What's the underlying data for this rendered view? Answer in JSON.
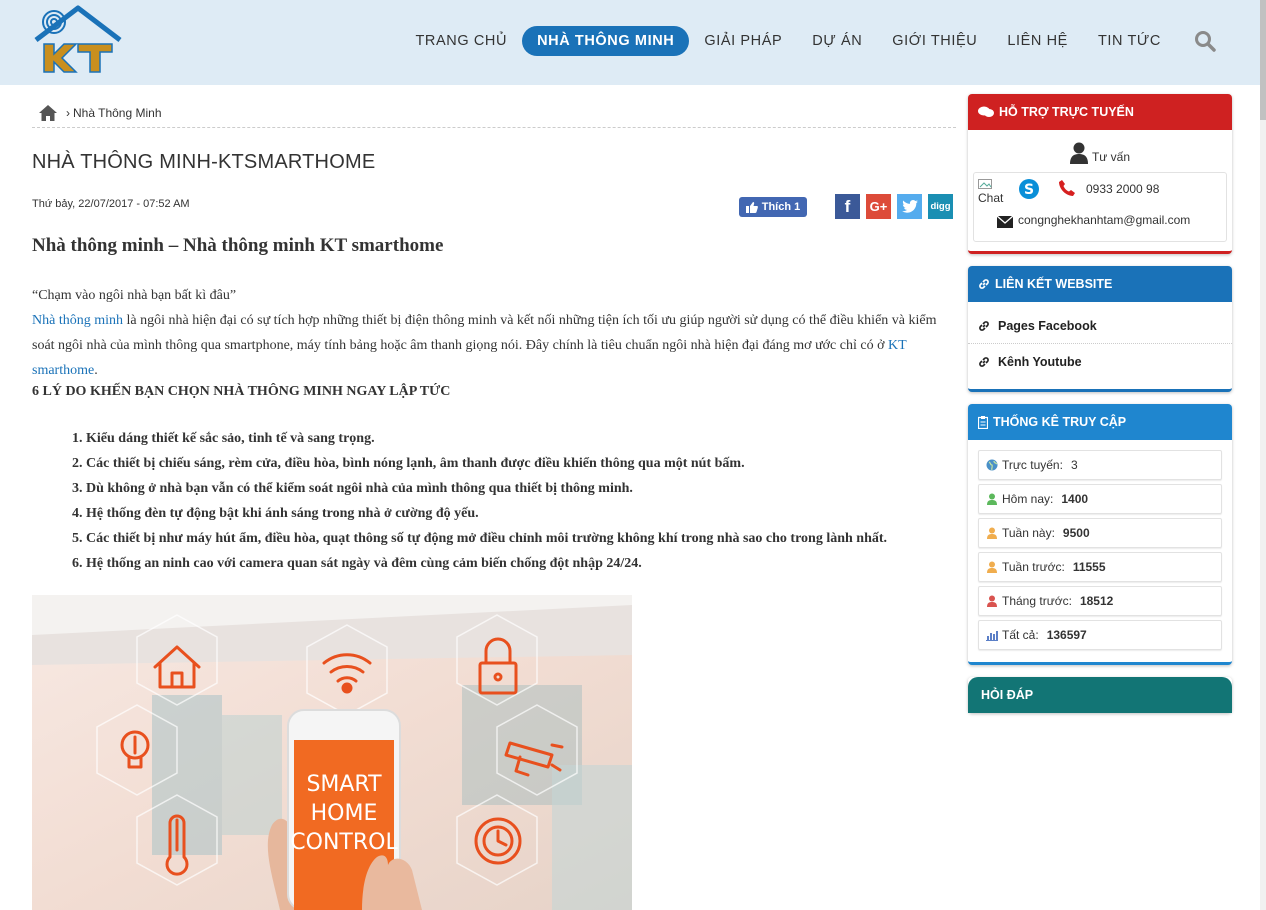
{
  "logo_text": "KT",
  "nav": {
    "items": [
      {
        "label": "TRANG CHỦ",
        "active": false
      },
      {
        "label": "NHÀ THÔNG MINH",
        "active": true
      },
      {
        "label": "GIẢI PHÁP",
        "active": false
      },
      {
        "label": "DỰ ÁN",
        "active": false
      },
      {
        "label": "GIỚI THIỆU",
        "active": false
      },
      {
        "label": "LIÊN HỆ",
        "active": false
      },
      {
        "label": "TIN TỨC",
        "active": false
      }
    ],
    "search_icon": "search-icon"
  },
  "breadcrumb": {
    "separator": "›",
    "current": "Nhà Thông Minh"
  },
  "page_title": "NHÀ THÔNG MINH-KTSMARTHOME",
  "post_date": "Thứ bảy, 22/07/2017 - 07:52 AM",
  "social": {
    "like_label": "Thích 1",
    "share": [
      {
        "name": "facebook",
        "glyph": "f",
        "color": "#3b5998"
      },
      {
        "name": "google-plus",
        "glyph": "G+",
        "color": "#dd4b39"
      },
      {
        "name": "twitter",
        "glyph": "t",
        "color": "#55acee"
      },
      {
        "name": "digg",
        "glyph": "digg",
        "color": "#1a8fb3"
      }
    ]
  },
  "article": {
    "heading": "Nhà thông minh – Nhà thông minh KT smarthome",
    "quote": "“Chạm vào ngôi nhà bạn bất kì đâu”",
    "intro_link": "Nhà thông minh",
    "intro_text": " là ngôi nhà hiện đại có sự tích hợp những thiết bị điện thông minh và kết nối những tiện ích tối ưu giúp người sử dụng có thể điều khiển và kiểm soát ngôi nhà của mình thông qua smartphone, máy tính bảng hoặc âm thanh giọng nói. Đây chính là tiêu chuẩn ngôi nhà hiện đại đáng mơ ước chỉ có ở ",
    "kt_link": "KT smarthome",
    "kt_after": ".",
    "reasons_title": "6 LÝ DO KHẾN BẠN CHỌN NHÀ THÔNG MINH NGAY LẬP TỨC",
    "reasons": [
      "1. Kiểu dáng thiết kế sắc sảo, tinh tế và sang trọng.",
      "2. Các thiết bị chiếu sáng, rèm cửa, điều hòa, bình nóng lạnh, âm thanh được điều khiển thông qua một nút bấm.",
      "3. Dù không ở nhà bạn vẫn có thể kiểm soát ngôi nhà của mình thông qua thiết bị thông minh.",
      "4. Hệ thống đèn tự động bật khi ánh sáng trong nhà ở cường độ yếu.",
      "5. Các thiết bị như máy hút ẩm, điều hòa, quạt thông số tự động mở điều chỉnh môi trường không khí trong nhà sao cho trong lành nhất.",
      "6. Hệ thống an ninh cao với camera quan sát ngày và đêm cùng cảm biến chống đột nhập 24/24."
    ],
    "image_text": [
      "SMART",
      "HOME",
      "CONTROL"
    ]
  },
  "sidebar": {
    "support": {
      "title": "HỖ TRỢ TRỰC TUYẾN",
      "consult_label": "Tư vấn",
      "chat_alt": "Chat",
      "phone": "0933 2000 98",
      "email": "congnghekhanhtam@gmail.com"
    },
    "links": {
      "title": "LIÊN KẾT WEBSITE",
      "items": [
        "Pages Facebook",
        "Kênh Youtube"
      ]
    },
    "stats": {
      "title": "THỐNG KÊ TRUY CẬP",
      "rows": [
        {
          "label": "Trực tuyến:",
          "value": "3",
          "icon": "globe-icon",
          "color": "#4a90c8"
        },
        {
          "label": "Hôm nay:",
          "value": "1400",
          "icon": "user-icon",
          "color": "#5cb85c"
        },
        {
          "label": "Tuần này:",
          "value": "9500",
          "icon": "user-icon",
          "color": "#f0ad4e"
        },
        {
          "label": "Tuần trước:",
          "value": "11555",
          "icon": "user-icon",
          "color": "#f0ad4e"
        },
        {
          "label": "Tháng trước:",
          "value": "18512",
          "icon": "user-icon",
          "color": "#d9534f"
        },
        {
          "label": "Tất cả:",
          "value": "136597",
          "icon": "bar-chart-icon",
          "color": "#5b7fc7"
        }
      ]
    },
    "faq": {
      "title": "HỎI ĐÁP"
    }
  }
}
